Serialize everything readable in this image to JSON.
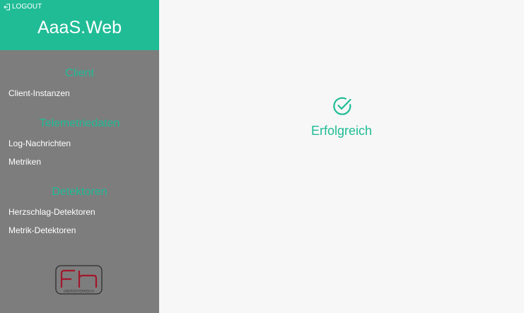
{
  "sidebar": {
    "logout_label": "LOGOUT",
    "app_title": "AaaS.Web",
    "sections": [
      {
        "title": "Client",
        "items": [
          "Client-Instanzen"
        ]
      },
      {
        "title": "Telemetriedaten",
        "items": [
          "Log-Nachrichten",
          "Metriken"
        ]
      },
      {
        "title": "Detektoren",
        "items": [
          "Herzschlag-Detektoren",
          "Metrik-Detektoren"
        ]
      }
    ],
    "logo": {
      "text": "OBERÖSTERREICH"
    }
  },
  "main": {
    "status_icon": "check-circle-icon",
    "status_text": "Erfolgreich"
  },
  "colors": {
    "accent": "#20bc96",
    "sidebar_bg": "#7d7d7d",
    "main_bg": "#f7f7f7",
    "logo_red": "#a3162a"
  }
}
